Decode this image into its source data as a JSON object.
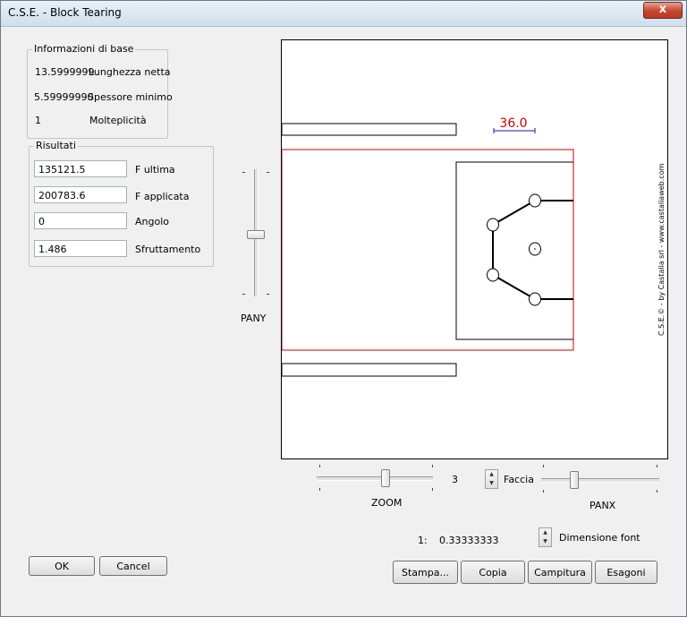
{
  "window": {
    "title": "C.S.E. - Block Tearing",
    "close_glyph": "x"
  },
  "info": {
    "group_title": "Informazioni di base",
    "rows": [
      {
        "value": "13.5999999",
        "label": "Lunghezza netta"
      },
      {
        "value": "5.59999990",
        "label": "Spessore minimo"
      },
      {
        "value": "1",
        "label": "Molteplicità"
      }
    ]
  },
  "results": {
    "group_title": "Risultati",
    "rows": [
      {
        "value": "135121.5",
        "label": "F ultima"
      },
      {
        "value": "200783.6",
        "label": "F applicata"
      },
      {
        "value": "0",
        "label": "Angolo"
      },
      {
        "value": "1.486",
        "label": "Sfruttamento"
      }
    ]
  },
  "drawing": {
    "dimension_label": "36.0",
    "credit": "C.S.E.© - by Castalia srl - www.castaliaweb.com",
    "colors": {
      "outline": "#000000",
      "block": "#cc0000",
      "dimension": "#1a1aa0"
    }
  },
  "controls": {
    "pany_label": "PANY",
    "zoom_label": "ZOOM",
    "zoom_value": "3",
    "faccia_label": "Faccia",
    "panx_label": "PANX",
    "scale_prefix": "1:",
    "scale_value": "0.33333333",
    "font_label": "Dimensione font"
  },
  "buttons": {
    "ok": "OK",
    "cancel": "Cancel",
    "print": "Stampa...",
    "copy": "Copia",
    "hatch": "Campitura",
    "hex": "Esagoni"
  }
}
